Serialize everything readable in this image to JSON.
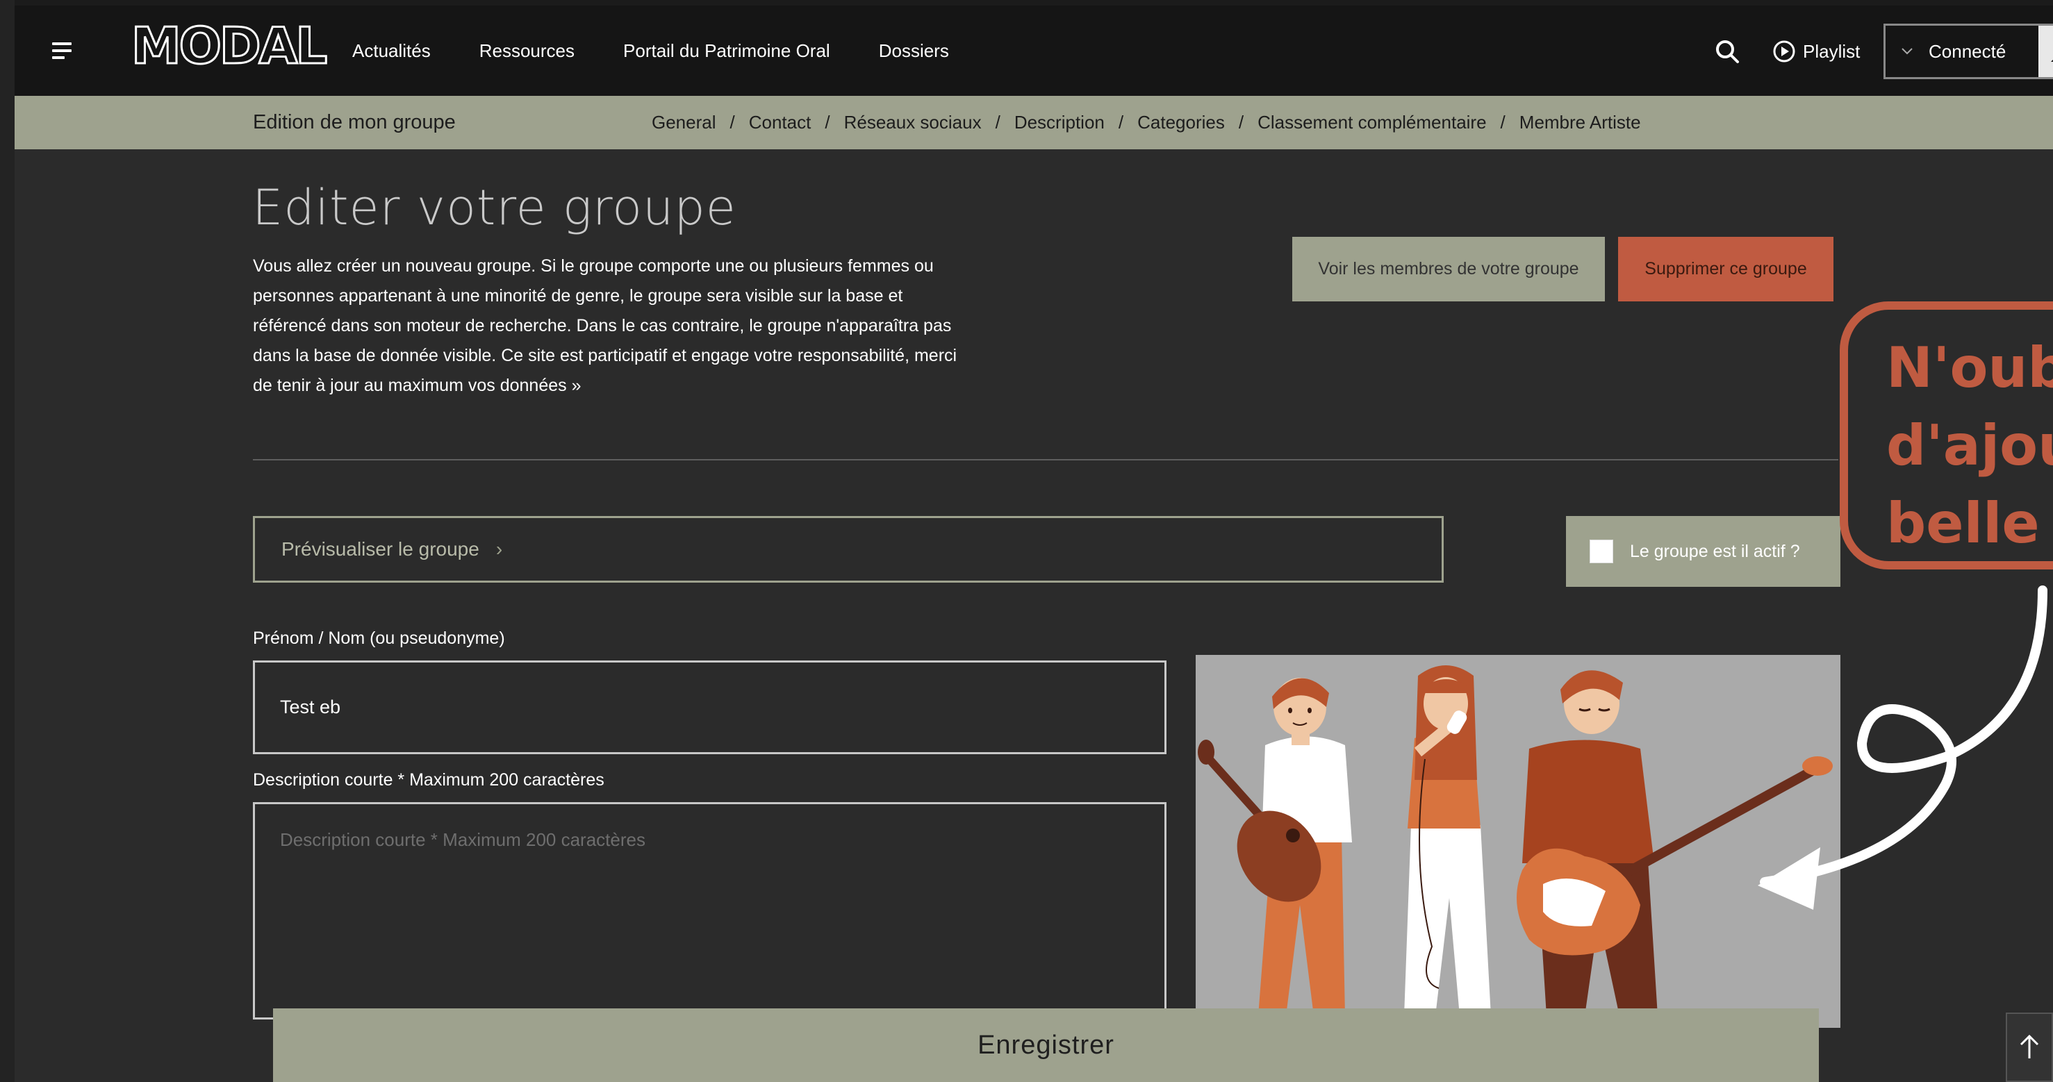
{
  "header": {
    "logo": "MODAL",
    "nav": [
      "Actualités",
      "Ressources",
      "Portail du Patrimoine Oral",
      "Dossiers"
    ],
    "playlist_label": "Playlist",
    "connect_label": "Connecté"
  },
  "subnav": {
    "title": "Edition de mon groupe",
    "crumbs": [
      "General",
      "Contact",
      "Réseaux sociaux",
      "Description",
      "Categories",
      "Classement complémentaire",
      "Membre Artiste"
    ]
  },
  "main": {
    "title": "Editer votre groupe",
    "intro_lines": [
      "Vous allez créer un nouveau groupe. Si le groupe comporte une ou plusieurs femmes ou",
      "personnes appartenant à une minorité de genre, le groupe sera visible sur la base et",
      "référencé dans son moteur de recherche. Dans le cas contraire, le groupe n'apparaîtra pas",
      "dans la base de donnée visible. Ce site est participatif et engage votre responsabilité, merci",
      "de tenir à jour au maximum vos données »"
    ],
    "btn_members": "Voir les membres de votre groupe",
    "btn_delete": "Supprimer ce groupe",
    "preview_label": "Prévisualiser le groupe",
    "preview_chevron": "›",
    "active_label": "Le groupe est il actif ?",
    "name_label": "Prénom / Nom (ou pseudonyme)",
    "name_value": "Test eb",
    "desc_label": "Description courte * Maximum 200 caractères",
    "desc_placeholder": "Description courte * Maximum 200 caractères",
    "save_label": "Enregistrer"
  },
  "callout": {
    "lines": [
      "N'oub",
      "d'ajou",
      "belle"
    ]
  },
  "colors": {
    "accent_green": "#9ea28e",
    "accent_red": "#c05b41",
    "background": "#2b2b2b",
    "header": "#151515"
  }
}
